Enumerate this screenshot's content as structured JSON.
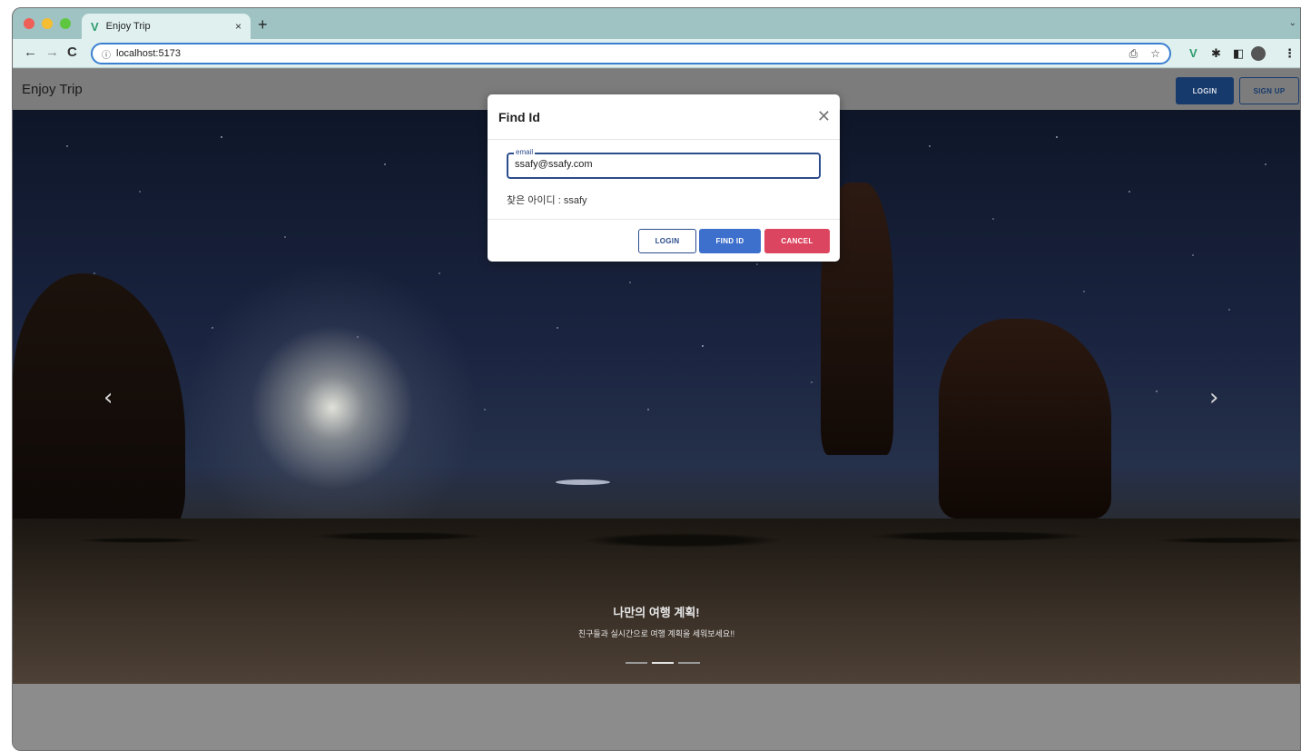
{
  "browser": {
    "tab_title": "Enjoy Trip",
    "tab_close": "×",
    "new_tab": "+",
    "tabs_dropdown": "⌄",
    "url": "localhost:5173",
    "icons": {
      "back": "←",
      "forward": "→",
      "reload": "C",
      "info": "ⓘ",
      "share": "⎙",
      "star": "☆",
      "vue": "V",
      "puzzle": "✱",
      "panel": "◧",
      "menu": "⋮"
    }
  },
  "app": {
    "brand": "Enjoy Trip",
    "login_label": "LOGIN",
    "signup_label": "SIGN UP"
  },
  "carousel": {
    "prev": "‹",
    "next": "›",
    "title": "나만의 여행 계획!",
    "subtitle": "친구들과 실시간으로 여행 계획을 세워보세요!!",
    "slide_count": 3,
    "active_index": 1
  },
  "modal": {
    "title": "Find Id",
    "close": "✕",
    "email_label": "email",
    "email_value": "ssafy@ssafy.com",
    "result": "찾은 아이디 : ssafy",
    "login_label": "LOGIN",
    "find_label": "FIND ID",
    "cancel_label": "CANCEL"
  }
}
